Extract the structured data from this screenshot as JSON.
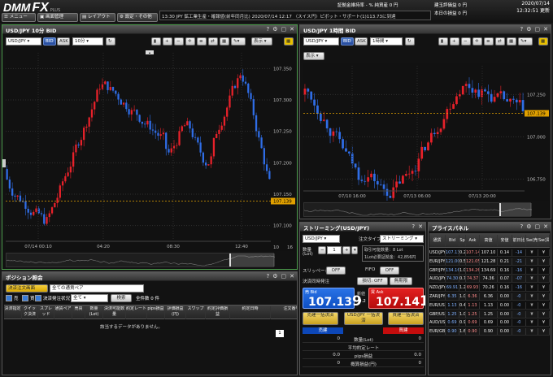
{
  "app": {
    "logo_main": "DMM",
    "logo_fx": "FX",
    "logo_plus": "PLUS",
    "menu": {
      "main": "メニュー",
      "screen": "画面管理",
      "layout": "レイアウト",
      "settings": "設定・その他"
    },
    "ticker": "13:30 JPY 鉱工業生産・確報値(前年同月比) 2020/07/14 12:17 〈スイス円〉ピボット・サポート(1)113.73に到達",
    "header_stats": [
      {
        "label": "証拠金維持率 -",
        "value": "% 純資産 0 円"
      },
      {
        "label": "建玉評価益 0 円",
        "value": "本日の損益 0 円"
      }
    ],
    "date": "2020/07/14",
    "time": "12:32:51 更新"
  },
  "chart_tf_bid": {
    "symbol": "USD/JPY",
    "timeframe": "10分",
    "side_bid": "BID",
    "side_ask": "ASK",
    "display": "表示",
    "colors": {
      "up": "#e8212a",
      "down": "#2f6de6",
      "current_line": "#e0a000"
    },
    "chart_data": {
      "type": "candlestick",
      "title": "USD/JPY 10分 BID",
      "price_ticks": [
        "107.350",
        "107.300",
        "107.250",
        "107.200",
        "107.150",
        "107.100"
      ],
      "time_ticks": [
        "07/14 00:10",
        "04:20",
        "08:30",
        "12:40"
      ],
      "x_range_labels": [
        "10",
        "16"
      ],
      "current_price": "107.139",
      "ylim": [
        107.075,
        107.375
      ]
    }
  },
  "chart_tf_1h": {
    "symbol": "USD/JPY",
    "timeframe": "1時間",
    "side_bid": "BID",
    "side_ask": "ASK",
    "display": "表示",
    "chart_data": {
      "type": "candlestick",
      "title": "USD/JPY 1時間 BID",
      "price_ticks": [
        "107.250",
        "107.000",
        "106.750"
      ],
      "time_ticks": [
        "07/10 16:00",
        "07/13 06:00",
        "07/13 20:00"
      ],
      "current_price": "107.139",
      "ylim": [
        106.68,
        107.42
      ]
    }
  },
  "streaming": {
    "title": "ストリーミング(USD/JPY)",
    "symbol": "USD/JPY",
    "order_type_label": "注文タイプ",
    "order_type": "ストリーミング",
    "qty_label": "数量",
    "qty_unit": "(Lot)",
    "qty_value": "1",
    "available_label": "取引可能数量：8 Lot",
    "margin_label": "1Lot必要証拠金：42,856円",
    "slippage_label": "スリッページ",
    "slippage_value": "OFF",
    "fifo_label": "FIFO",
    "fifo_value": "OFF",
    "settle_label": "決済同時発注",
    "settle_limit": "損切: OFF",
    "settle_stop": "無期限",
    "sell": {
      "label": "売 Bid",
      "big": "107.13",
      "small": "9"
    },
    "buy": {
      "label": "買 Ask",
      "big": "107.14",
      "small": "1"
    },
    "spread_label": "新値",
    "spread": "0.2",
    "bulk_sell": "売建一括決済",
    "bulk_all": "USD/JPY 一括決済",
    "bulk_buy": "買建一括決済",
    "sell_col": "売建",
    "buy_col": "買建",
    "summary_rows": [
      {
        "label": "数量(Lot)",
        "sell": "0",
        "buy": "0"
      },
      {
        "label": "平均約定レート",
        "sell": "",
        "buy": ""
      },
      {
        "label": "pips損益",
        "sell": "0.0",
        "buy": "0.0"
      },
      {
        "label": "概算損益(円)",
        "sell": "0",
        "buy": "0"
      }
    ]
  },
  "price_panel": {
    "title": "プライスパネル",
    "headers": [
      "通貨",
      "Bid",
      "Sp",
      "Ask",
      "高値",
      "安値",
      "前日比",
      "Sw(売)",
      "Sw(買)"
    ],
    "rows": [
      {
        "pair": "USD/JPY",
        "bid": "107.13",
        "sp": "0.2",
        "ask": "107.14",
        "hi": "107.10",
        "lo": "0.14",
        "chg": "-14",
        "s1": "¥",
        "s2": "¥"
      },
      {
        "pair": "EUR/JPY",
        "bid": "121.00",
        "sp": "0.5",
        "ask": "121.05",
        "hi": "121.28",
        "lo": "0.21",
        "chg": "-21",
        "s1": "¥",
        "s2": "¥"
      },
      {
        "pair": "GBP/JPY",
        "bid": "134.16",
        "sp": "1.0",
        "ask": "134.26",
        "hi": "134.69",
        "lo": "0.16",
        "chg": "-16",
        "s1": "¥",
        "s2": "¥"
      },
      {
        "pair": "AUD/JPY",
        "bid": "74.30",
        "sp": "0.7",
        "ask": "74.37",
        "hi": "74.36",
        "lo": "0.07",
        "chg": "-07",
        "s1": "¥",
        "s2": "¥"
      },
      {
        "pair": "NZD/JPY",
        "bid": "69.91",
        "sp": "1.2",
        "ask": "69.93",
        "hi": "70.26",
        "lo": "0.16",
        "chg": "-16",
        "s1": "¥",
        "s2": "¥"
      },
      {
        "pair": "ZAR/JPY",
        "bid": "6.35",
        "sp": "1.0",
        "ask": "6.36",
        "hi": "6.36",
        "lo": "0.00",
        "chg": "-0",
        "s1": "¥",
        "s2": "¥"
      },
      {
        "pair": "EUR/USD",
        "bid": "1.13",
        "sp": "0.4",
        "ask": "1.13",
        "hi": "1.13",
        "lo": "0.00",
        "chg": "-0",
        "s1": "¥",
        "s2": "¥"
      },
      {
        "pair": "GBP/USD",
        "bid": "1.25",
        "sp": "1.0",
        "ask": "1.25",
        "hi": "1.25",
        "lo": "0.00",
        "chg": "-0",
        "s1": "¥",
        "s2": "¥"
      },
      {
        "pair": "AUD/USD",
        "bid": "0.69",
        "sp": "0.9",
        "ask": "0.69",
        "hi": "0.69",
        "lo": "0.00",
        "chg": "-0",
        "s1": "¥",
        "s2": "¥"
      },
      {
        "pair": "EUR/GBP",
        "bid": "0.90",
        "sp": "1.6",
        "ask": "0.90",
        "hi": "0.90",
        "lo": "0.00",
        "chg": "-0",
        "s1": "¥",
        "s2": "¥"
      }
    ]
  },
  "positions": {
    "title": "ポジション照会",
    "tab_label": "決済注文画面",
    "pair_filter_placeholder": "全ての通貨ペア",
    "cb_all": "売",
    "cb_buy": "買",
    "cb_settled_label": "決済発注状況",
    "cb_settled_value": "全て",
    "search_btn": "検索",
    "count_label": "全件数 0 件",
    "headers": [
      "決済指定",
      "クイック決済",
      "スプレッド",
      "通貨ペア",
      "売買",
      "数量(Lot)",
      "決済可能数量",
      "約定レート",
      "pips損益",
      "評価損益(円)",
      "スワップ",
      "約定評価損益",
      "約定日時",
      "注文番号"
    ],
    "empty_message": "該当するデータがありません。",
    "page": "1"
  }
}
